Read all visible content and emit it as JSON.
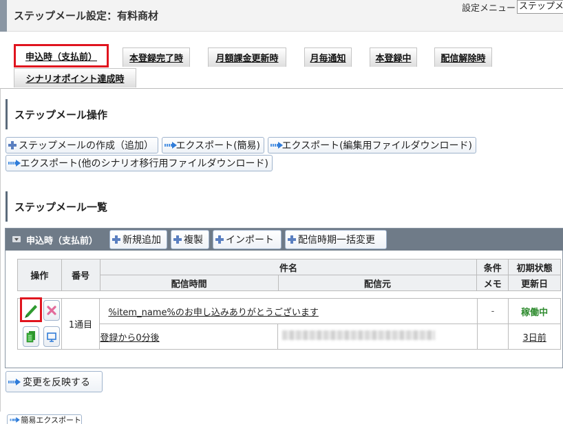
{
  "header": {
    "title": "ステップメール設定：有料商材",
    "settings_label": "設定メニュー",
    "settings_value": "ステップメー"
  },
  "tabs": [
    {
      "label": "申込時（支払前）",
      "active": true
    },
    {
      "label": "本登録完了時"
    },
    {
      "label": "月額課金更新時"
    },
    {
      "label": "月毎通知"
    },
    {
      "label": "本登録中"
    },
    {
      "label": "配信解除時"
    },
    {
      "label": "シナリオポイント達成時"
    }
  ],
  "ops": {
    "title": "ステップメール操作",
    "create": "ステップメールの作成（追加）",
    "export_simple": "エクスポート(簡易)",
    "export_edit": "エクスポート(編集用ファイルダウンロード)",
    "export_other": "エクスポート(他のシナリオ移行用ファイルダウンロード)"
  },
  "list": {
    "title": "ステップメール一覧",
    "panel_title": "申込時（支払前）",
    "add": "新規追加",
    "copy": "複製",
    "import": "インポート",
    "bulk_change": "配信時期一括変更"
  },
  "table": {
    "headers": {
      "ops": "操作",
      "num": "番号",
      "subject": "件名",
      "condition": "条件",
      "initial_state": "初期状態",
      "send_time": "配信時間",
      "sender": "配信元",
      "memo": "メモ",
      "updated": "更新日"
    },
    "row": {
      "num": "1通目",
      "subject": "%item_name%のお申し込みありがとうございます",
      "condition": "-",
      "status": "稼働中",
      "send_time": "登録から0分後",
      "memo": "",
      "updated": "3日前"
    }
  },
  "footer": {
    "apply": "変更を反映する",
    "simple_export": "簡易エクスポート"
  },
  "colors": {
    "highlight": "#e0141e",
    "status_active": "#2e8b2e",
    "panel_header": "#6f7b88"
  }
}
